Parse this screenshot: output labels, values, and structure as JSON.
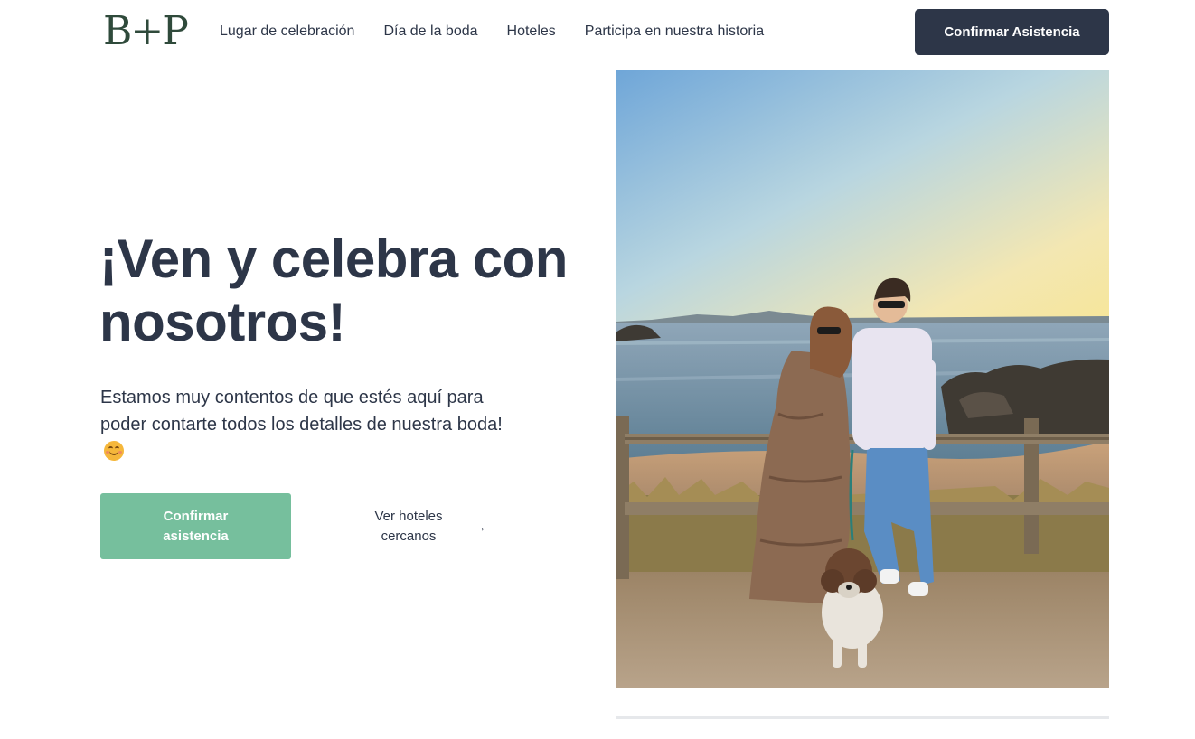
{
  "header": {
    "logo": "B+P",
    "nav": [
      {
        "label": "Lugar de celebración"
      },
      {
        "label": "Día de la boda"
      },
      {
        "label": "Hoteles"
      },
      {
        "label": "Participa en nuestra historia"
      }
    ],
    "cta_label": "Confirmar Asistencia"
  },
  "hero": {
    "title": "¡Ven y celebra con nosotros!",
    "subtitle": "Estamos muy contentos de que estés aquí para poder contarte todos los detalles de nuestra boda!",
    "emoji_icon": "smiling-face-icon",
    "primary_button": "Confirmar asistencia",
    "secondary_link": "Ver hoteles cercanos",
    "secondary_icon": "arrow-right-icon"
  },
  "colors": {
    "dark": "#2d3648",
    "accent_green": "#76bf9d",
    "logo_green": "#2f4a3b"
  }
}
